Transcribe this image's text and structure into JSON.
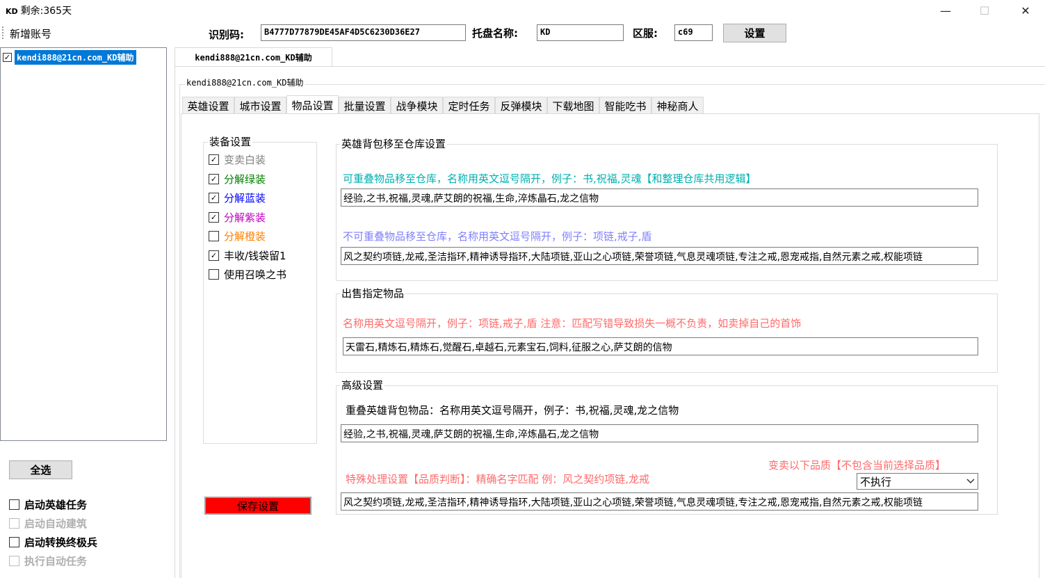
{
  "window": {
    "logo": "KD",
    "title": "剩余:365天",
    "minimize": "—",
    "maximize": "☐",
    "close": "✕"
  },
  "top": {
    "add_account": "新增账号",
    "id_label": "识别码:",
    "id_value": "B4777D77879DE45AF4D5C6230D36E27",
    "host_label": "托盘名称:",
    "host_value": "KD",
    "server_label": "区服:",
    "server_value": "c69",
    "set_button": "设置"
  },
  "accounts": [
    {
      "label": "kendi888@21cn.com_KD辅助",
      "checked": true
    }
  ],
  "left_bottom": {
    "select_all": "全选",
    "options": [
      {
        "label": "启动英雄任务",
        "checked": false,
        "enabled": true
      },
      {
        "label": "启动自动建筑",
        "checked": false,
        "enabled": false
      },
      {
        "label": "启动转换终极兵",
        "checked": false,
        "enabled": true
      },
      {
        "label": "执行自动任务",
        "checked": false,
        "enabled": false
      }
    ]
  },
  "account_tab": "kendi888@21cn.com_KD辅助",
  "group_title": "kendi888@21cn.com_KD辅助",
  "tabs": [
    "英雄设置",
    "城市设置",
    "物品设置",
    "批量设置",
    "战争模块",
    "定时任务",
    "反弹模块",
    "下载地图",
    "智能吃书",
    "神秘商人"
  ],
  "active_tab": 2,
  "equipment": {
    "title": "装备设置",
    "items": [
      {
        "label": "变卖白装",
        "checked": true,
        "color": "#808080"
      },
      {
        "label": "分解绿装",
        "checked": true,
        "color": "#008000"
      },
      {
        "label": "分解蓝装",
        "checked": true,
        "color": "#0000ff"
      },
      {
        "label": "分解紫装",
        "checked": true,
        "color": "#c000c0"
      },
      {
        "label": "分解橙装",
        "checked": false,
        "color": "#ff8000"
      },
      {
        "label": "丰收/钱袋留1",
        "checked": true,
        "color": "#000000"
      },
      {
        "label": "使用召唤之书",
        "checked": false,
        "color": "#000000"
      }
    ],
    "save_button": "保存设置"
  },
  "move_group": {
    "title": "英雄背包移至仓库设置",
    "hint1": "可重叠物品移至仓库，名称用英文逗号隔开，例子：书,祝福,灵魂【和整理仓库共用逻辑】",
    "value1": "经验,之书,祝福,灵魂,萨艾朗的祝福,生命,淬炼晶石,龙之信物",
    "hint2": "不可重叠物品移至仓库，名称用英文逗号隔开，例子：项链,戒子,盾",
    "value2": "风之契约项链,龙戒,圣洁指环,精神诱导指环,大陆项链,亚山之心项链,荣誉项链,气息灵魂项链,专注之戒,恩宠戒指,自然元素之戒,权能项链"
  },
  "sell_group": {
    "title": "出售指定物品",
    "hint": "名称用英文逗号隔开，例子：项链,戒子,盾   注意：匹配写错导致损失一概不负责，如卖掉自己的首饰",
    "value": "天雷石,精炼石,精炼石,觉醒石,卓越石,元素宝石,饲料,征服之心,萨艾朗的信物"
  },
  "adv_group": {
    "title": "高级设置",
    "hint1": "重叠英雄背包物品：名称用英文逗号隔开，例子：书,祝福,灵魂,龙之信物",
    "value1": "经验,之书,祝福,灵魂,萨艾朗的祝福,生命,淬炼晶石,龙之信物",
    "sell_quality_label": "变卖以下品质【不包含当前选择品质】",
    "special_hint": "特殊处理设置【品质判断】：精确名字匹配  例：风之契约项链,龙戒",
    "quality_select": "不执行",
    "value2": "风之契约项链,龙戒,圣洁指环,精神诱导指环,大陆项链,亚山之心项链,荣誉项链,气息灵魂项链,专注之戒,恩宠戒指,自然元素之戒,权能项链"
  },
  "colors": {
    "cyan_hint": "#00b0b0",
    "blue_hint": "#7f7fff",
    "red_hint": "#ff6a6a",
    "save_red": "#ff0000",
    "select_blue": "#0078d7"
  }
}
